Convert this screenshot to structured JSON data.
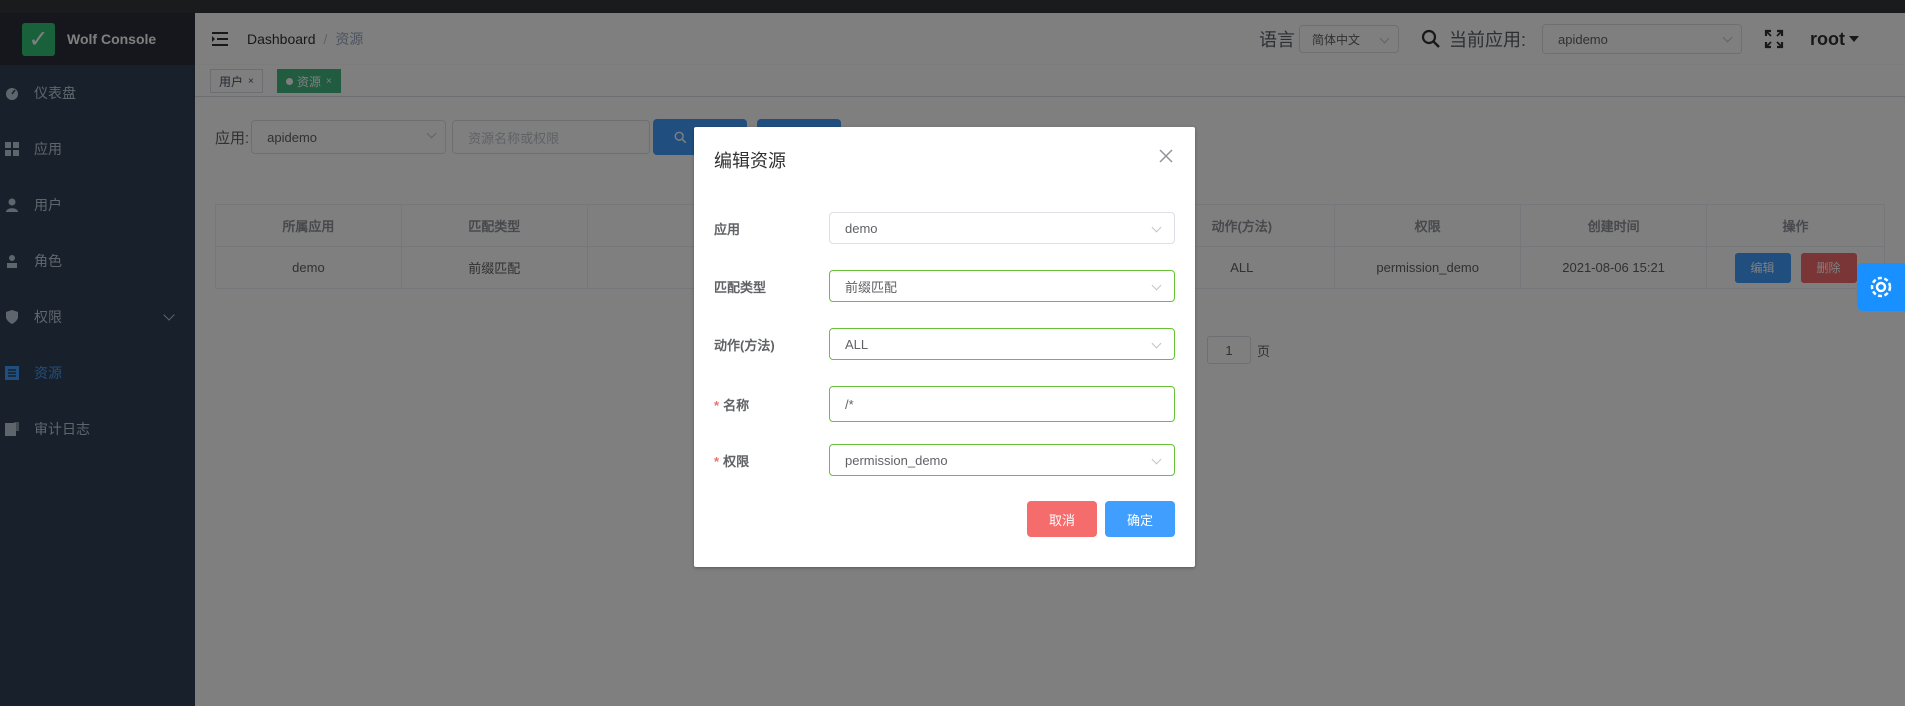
{
  "app": {
    "title": "Wolf Console"
  },
  "sidebar": {
    "items": [
      {
        "label": "仪表盘",
        "icon": "dashboard-icon"
      },
      {
        "label": "应用",
        "icon": "grid-icon"
      },
      {
        "label": "用户",
        "icon": "user-icon"
      },
      {
        "label": "角色",
        "icon": "role-icon"
      },
      {
        "label": "权限",
        "icon": "shield-icon"
      },
      {
        "label": "资源",
        "icon": "list-icon"
      },
      {
        "label": "审计日志",
        "icon": "log-icon"
      }
    ]
  },
  "navbar": {
    "breadcrumb_home": "Dashboard",
    "breadcrumb_sep": "/",
    "breadcrumb_current": "资源",
    "language_label": "语言",
    "language_value": "简体中文",
    "current_app_label": "当前应用:",
    "current_app_value": "apidemo",
    "user": "root"
  },
  "tags": {
    "first": "用户",
    "second": "资源",
    "close": "×"
  },
  "filter": {
    "app_label": "应用:",
    "app_value": "apidemo",
    "search_placeholder": "资源名称或权限"
  },
  "table": {
    "headers": [
      "所属应用",
      "匹配类型",
      "",
      "动作(方法)",
      "权限",
      "创建时间",
      "操作"
    ],
    "rows": [
      {
        "app": "demo",
        "match_type": "前缀匹配",
        "name": "",
        "action": "ALL",
        "permission": "permission_demo",
        "created": "2021-08-06 15:21"
      }
    ],
    "edit_label": "编辑",
    "delete_label": "删除"
  },
  "pagination": {
    "page": "1",
    "suffix": "页"
  },
  "dialog": {
    "title": "编辑资源",
    "fields": [
      {
        "label": "应用",
        "value": "demo",
        "required": false
      },
      {
        "label": "匹配类型",
        "value": "前缀匹配",
        "required": false
      },
      {
        "label": "动作(方法)",
        "value": "ALL",
        "required": false
      },
      {
        "label": "名称",
        "value": "/*",
        "required": true
      },
      {
        "label": "权限",
        "value": "permission_demo",
        "required": true
      }
    ],
    "required_mark": "*",
    "cancel_label": "取消",
    "confirm_label": "确定"
  },
  "colors": {
    "primary": "#409eff",
    "danger": "#f56c6c",
    "success": "#42b983",
    "sidebar_bg": "#304156"
  }
}
